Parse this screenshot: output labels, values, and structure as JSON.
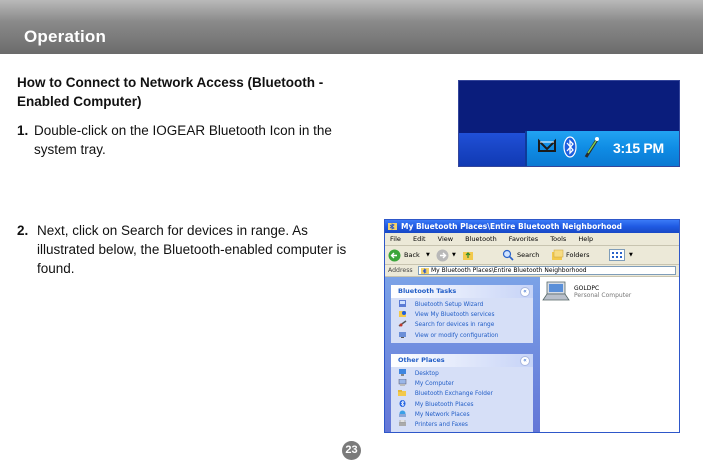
{
  "header": {
    "title": "Operation"
  },
  "section": {
    "heading": "How to Connect to Network Access (Bluetooth - Enabled Computer)",
    "steps": [
      {
        "number": "1.",
        "text": "Double-click on the IOGEAR Bluetooth Icon in the system  tray."
      },
      {
        "number": "2.",
        "text": "Next, click on Search for devices in range.  As illustrated below, the Bluetooth-enabled computer is found."
      }
    ]
  },
  "tray": {
    "time": "3:15 PM"
  },
  "explorer": {
    "title": "My Bluetooth Places\\Entire Bluetooth Neighborhood",
    "menu": [
      "File",
      "Edit",
      "View",
      "Bluetooth",
      "Favorites",
      "Tools",
      "Help"
    ],
    "toolbar": {
      "back": "Back",
      "search": "Search",
      "folders": "Folders"
    },
    "address": {
      "label": "Address",
      "value": "My Bluetooth Places\\Entire Bluetooth Neighborhood"
    },
    "tasks": {
      "title": "Bluetooth Tasks",
      "items": [
        "Bluetooth Setup Wizard",
        "View My Bluetooth services",
        "Search for devices in range",
        "View or modify configuration"
      ]
    },
    "places": {
      "title": "Other Places",
      "items": [
        "Desktop",
        "My Computer",
        "Bluetooth Exchange Folder",
        "My Bluetooth Places",
        "My Network Places",
        "Printers and Faxes"
      ]
    },
    "device": {
      "name": "GOLDPC",
      "type": "Personal Computer"
    }
  },
  "page": {
    "number": "23"
  }
}
